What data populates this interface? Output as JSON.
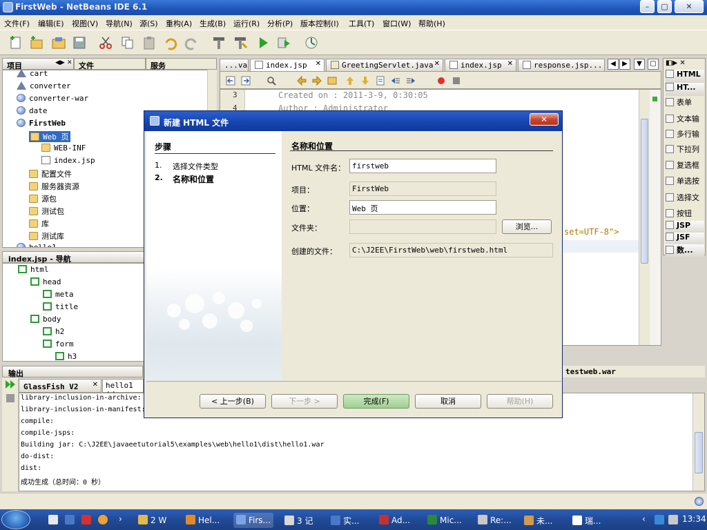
{
  "window": {
    "title": "FirstWeb - NetBeans IDE 6.1",
    "min": "–",
    "max": "▢",
    "close": "✕"
  },
  "menu": [
    "文件(F)",
    "编辑(E)",
    "视图(V)",
    "导航(N)",
    "源(S)",
    "重构(A)",
    "生成(B)",
    "运行(R)",
    "分析(P)",
    "版本控制(I)",
    "工具(T)",
    "窗口(W)",
    "帮助(H)"
  ],
  "panels": {
    "projects_tab": "项目",
    "files_tab": "文件",
    "services_tab": "服务",
    "tree": [
      {
        "label": "cart",
        "icon": "triangle-icon",
        "level": 0
      },
      {
        "label": "converter",
        "icon": "triangle-icon",
        "level": 0
      },
      {
        "label": "converter-war",
        "icon": "globe-icon",
        "level": 0
      },
      {
        "label": "date",
        "icon": "globe-icon",
        "level": 0
      },
      {
        "label": "FirstWeb",
        "icon": "globe-icon",
        "level": 0
      },
      {
        "label": "Web 页",
        "icon": "folder-icon",
        "level": 1
      },
      {
        "label": "WEB-INF",
        "icon": "folder-icon",
        "level": 2
      },
      {
        "label": "index.jsp",
        "icon": "file-icon",
        "level": 2
      },
      {
        "label": "配置文件",
        "icon": "folder-icon",
        "level": 1
      },
      {
        "label": "服务器资源",
        "icon": "folder-icon",
        "level": 1
      },
      {
        "label": "源包",
        "icon": "folder-icon",
        "level": 1
      },
      {
        "label": "测试包",
        "icon": "folder-icon",
        "level": 1
      },
      {
        "label": "库",
        "icon": "folder-icon",
        "level": 1
      },
      {
        "label": "测试库",
        "icon": "folder-icon",
        "level": 1
      },
      {
        "label": "hello1",
        "icon": "globe-icon",
        "level": 0
      }
    ],
    "navigator_title": "index.jsp - 导航",
    "navigator": [
      {
        "label": "html",
        "level": 0
      },
      {
        "label": "head",
        "level": 1
      },
      {
        "label": "meta",
        "level": 2
      },
      {
        "label": "title",
        "level": 2
      },
      {
        "label": "body",
        "level": 1
      },
      {
        "label": "h2",
        "level": 2
      },
      {
        "label": "form",
        "level": 2
      },
      {
        "label": "h3",
        "level": 3
      }
    ]
  },
  "editor": {
    "tabs": [
      "...va",
      "index.jsp",
      "GreetingServlet.java",
      "index.jsp",
      "response.jsp..."
    ],
    "lines": [
      {
        "num": "3",
        "text": "Created on : 2011-3-9, 0:30:05"
      },
      {
        "num": "4",
        "text": "Author     : Administrator"
      }
    ],
    "charset_fragment": "set=UTF-8\">"
  },
  "palette": [
    "HTML",
    "HT...",
    "表单",
    "文本输",
    "多行输",
    "下拉列",
    "复选框",
    "单选按",
    "选择文",
    "按钮",
    "JSP",
    "JSF",
    "数..."
  ],
  "dialog": {
    "title": "新建 HTML 文件",
    "close": "✕",
    "steps_header": "步骤",
    "steps": [
      {
        "num": "1.",
        "label": "选择文件类型"
      },
      {
        "num": "2.",
        "label": "名称和位置"
      }
    ],
    "section_title": "名称和位置",
    "filename_label": "HTML 文件名：",
    "filename_value": "firstweb",
    "project_label": "项目：",
    "project_value": "FirstWeb",
    "location_label": "位置：",
    "location_value": "Web 页",
    "folder_label": "文件夹：",
    "folder_value": "",
    "browse": "浏览...",
    "created_label": "创建的文件：",
    "created_value": "C:\\J2EE\\FirstWeb\\web\\firstweb.html",
    "buttons": {
      "back": "< 上一步(B)",
      "next": "下一步 >",
      "finish": "完成(F)",
      "cancel": "取消",
      "help": "帮助(H)"
    }
  },
  "output": {
    "title": "输出",
    "tabs": [
      "GlassFish V2",
      "hello1 (d"
    ],
    "right_tab": "testweb.war",
    "lines": [
      "library-inclusion-in-archive:",
      "library-inclusion-in-manifest:",
      "compile:",
      "compile-jsps:",
      "Building jar: C:\\J2EE\\javaeetutorial5\\examples\\web\\hello1\\dist\\hello1.war",
      "do-dist:",
      "dist:",
      "成功生成（总时间：0 秒）"
    ]
  },
  "taskbar": {
    "items": [
      {
        "label": "2 W",
        "color": "#e6b84a"
      },
      {
        "label": "Hel...",
        "color": "#e08a2a"
      },
      {
        "label": "Firs...",
        "color": "#7aa4e6"
      },
      {
        "label": "3 记",
        "color": "#d8d8d8"
      },
      {
        "label": "实...",
        "color": "#4a78c8"
      },
      {
        "label": "Ad...",
        "color": "#c83030"
      },
      {
        "label": "Mic...",
        "color": "#2a8a3a"
      },
      {
        "label": "Re:...",
        "color": "#c8c8c8"
      },
      {
        "label": "未...",
        "color": "#d09a50"
      },
      {
        "label": "瑞...",
        "color": "#ffffff"
      }
    ],
    "clock": "13:34"
  }
}
